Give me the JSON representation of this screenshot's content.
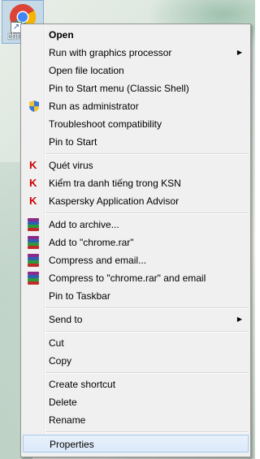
{
  "desktop": {
    "icon_label": "chrome"
  },
  "menu": {
    "groups": [
      [
        {
          "label": "Open",
          "bold": true,
          "icon": "",
          "submenu": false
        },
        {
          "label": "Run with graphics processor",
          "icon": "",
          "submenu": true
        },
        {
          "label": "Open file location",
          "icon": "",
          "submenu": false
        },
        {
          "label": "Pin to Start menu (Classic Shell)",
          "icon": "",
          "submenu": false
        },
        {
          "label": "Run as administrator",
          "icon": "uac-shield-icon",
          "submenu": false
        },
        {
          "label": "Troubleshoot compatibility",
          "icon": "",
          "submenu": false
        },
        {
          "label": "Pin to Start",
          "icon": "",
          "submenu": false
        }
      ],
      [
        {
          "label": "Quét virus",
          "icon": "kaspersky-icon",
          "submenu": false
        },
        {
          "label": "Kiểm tra danh tiếng trong KSN",
          "icon": "kaspersky-icon",
          "submenu": false
        },
        {
          "label": "Kaspersky Application Advisor",
          "icon": "kaspersky-icon",
          "submenu": false
        }
      ],
      [
        {
          "label": "Add to archive...",
          "icon": "winrar-icon",
          "submenu": false
        },
        {
          "label": "Add to \"chrome.rar\"",
          "icon": "winrar-icon",
          "submenu": false
        },
        {
          "label": "Compress and email...",
          "icon": "winrar-icon",
          "submenu": false
        },
        {
          "label": "Compress to \"chrome.rar\" and email",
          "icon": "winrar-icon",
          "submenu": false
        },
        {
          "label": "Pin to Taskbar",
          "icon": "",
          "submenu": false
        }
      ],
      [
        {
          "label": "Send to",
          "icon": "",
          "submenu": true
        }
      ],
      [
        {
          "label": "Cut",
          "icon": "",
          "submenu": false
        },
        {
          "label": "Copy",
          "icon": "",
          "submenu": false
        }
      ],
      [
        {
          "label": "Create shortcut",
          "icon": "",
          "submenu": false
        },
        {
          "label": "Delete",
          "icon": "",
          "submenu": false
        },
        {
          "label": "Rename",
          "icon": "",
          "submenu": false
        }
      ],
      [
        {
          "label": "Properties",
          "icon": "",
          "submenu": false,
          "selected": true
        }
      ]
    ]
  }
}
